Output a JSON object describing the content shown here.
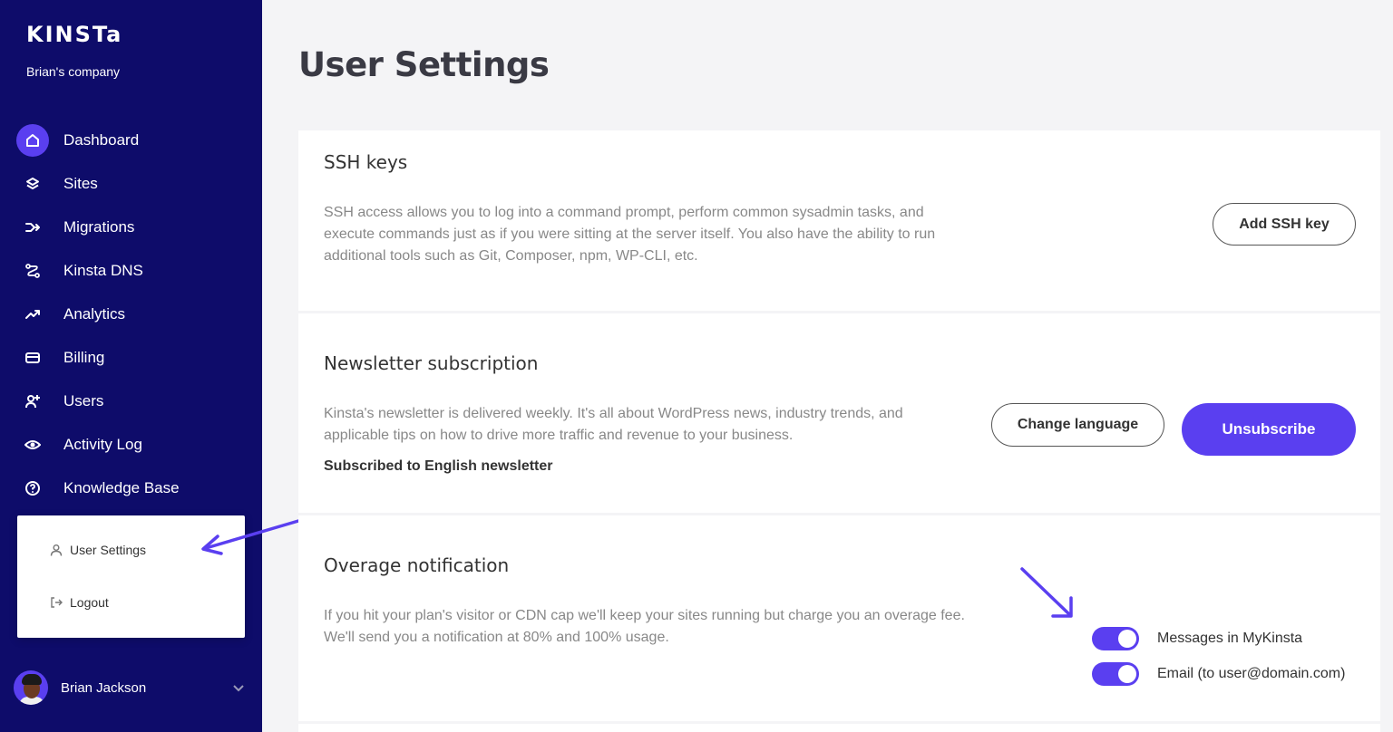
{
  "brand": {
    "logo": "KINSTa",
    "company": "Brian's company"
  },
  "colors": {
    "sidebar": "#0e0c6a",
    "accent": "#5a3ff0"
  },
  "nav": [
    {
      "label": "Dashboard",
      "icon": "home-icon",
      "active": true
    },
    {
      "label": "Sites",
      "icon": "layers-icon"
    },
    {
      "label": "Migrations",
      "icon": "migrate-icon"
    },
    {
      "label": "Kinsta DNS",
      "icon": "dns-icon"
    },
    {
      "label": "Analytics",
      "icon": "trend-icon"
    },
    {
      "label": "Billing",
      "icon": "card-icon"
    },
    {
      "label": "Users",
      "icon": "user-plus-icon"
    },
    {
      "label": "Activity Log",
      "icon": "eye-icon"
    },
    {
      "label": "Knowledge Base",
      "icon": "help-icon"
    }
  ],
  "popup": {
    "user_settings": "User Settings",
    "logout": "Logout"
  },
  "user": {
    "name": "Brian Jackson"
  },
  "page": {
    "title": "User Settings"
  },
  "ssh": {
    "title": "SSH keys",
    "desc1": "SSH access allows you to log into a command prompt, perform common sysadmin tasks, and",
    "desc2": "execute commands just as if you were sitting at the server itself. You also have the ability to run",
    "desc3": "additional tools such as Git, Composer, npm, WP-CLI, etc.",
    "button": "Add SSH key"
  },
  "newsletter": {
    "title": "Newsletter subscription",
    "desc1": "Kinsta's newsletter is delivered weekly. It's all about WordPress news, industry trends, and",
    "desc2": "applicable tips on how to drive more traffic and revenue to your business.",
    "status": "Subscribed to English newsletter",
    "change_button": "Change language",
    "unsubscribe_button": "Unsubscribe"
  },
  "overage": {
    "title": "Overage notification",
    "desc1": "If you hit your plan's visitor or CDN cap we'll keep your sites running but charge you an overage fee.",
    "desc2": "We'll send you a notification at 80% and 100% usage.",
    "toggle1": {
      "label": "Messages in MyKinsta",
      "on": true
    },
    "toggle2": {
      "label": "Email (to user@domain.com)",
      "on": true
    }
  }
}
